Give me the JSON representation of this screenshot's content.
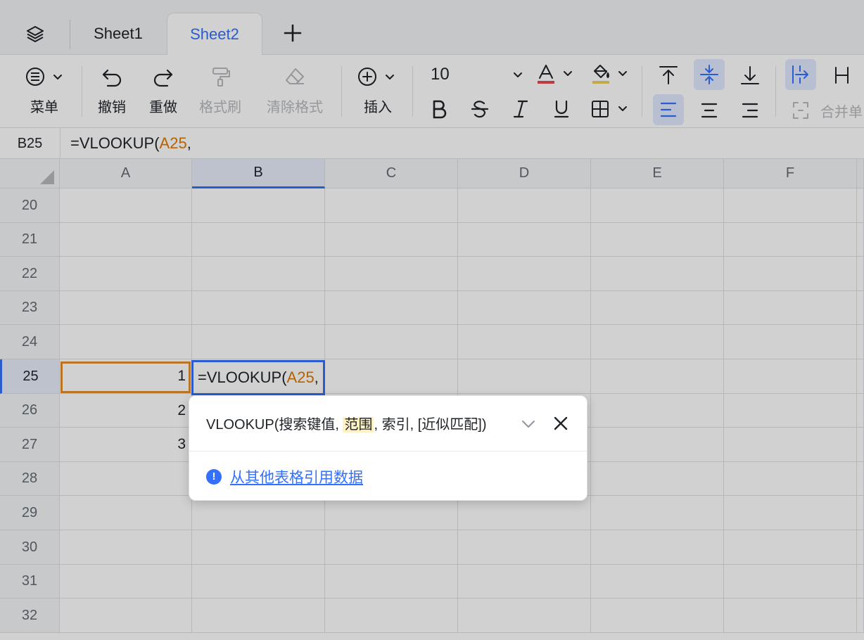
{
  "tabs": {
    "items": [
      {
        "label": "Sheet1",
        "active": false
      },
      {
        "label": "Sheet2",
        "active": true
      }
    ]
  },
  "toolbar": {
    "menu_label": "菜单",
    "undo_label": "撤销",
    "redo_label": "重做",
    "format_painter_label": "格式刷",
    "clear_format_label": "清除格式",
    "insert_label": "插入",
    "font_size": "10",
    "merge_label": "合并单"
  },
  "formula_bar": {
    "cell_ref": "B25",
    "formula_prefix": "=VLOOKUP(",
    "formula_ref": "A25",
    "formula_suffix": ","
  },
  "columns": [
    "A",
    "B",
    "C",
    "D",
    "E",
    "F"
  ],
  "rows": [
    "20",
    "21",
    "22",
    "23",
    "24",
    "25",
    "26",
    "27",
    "28",
    "29",
    "30",
    "31",
    "32"
  ],
  "cells": {
    "A25": "1",
    "A26": "2",
    "A27": "3"
  },
  "editor": {
    "prefix": "=VLOOKUP(",
    "ref": "A25",
    "suffix": ","
  },
  "function_hint": {
    "sig_start": "VLOOKUP(搜索键值, ",
    "sig_highlight": "范围",
    "sig_end": ", 索引, [近似匹配])",
    "link_text": "从其他表格引用数据"
  },
  "colors": {
    "accent": "#3370ff",
    "reference": "#de7802",
    "highlight": "#fef1c4"
  }
}
